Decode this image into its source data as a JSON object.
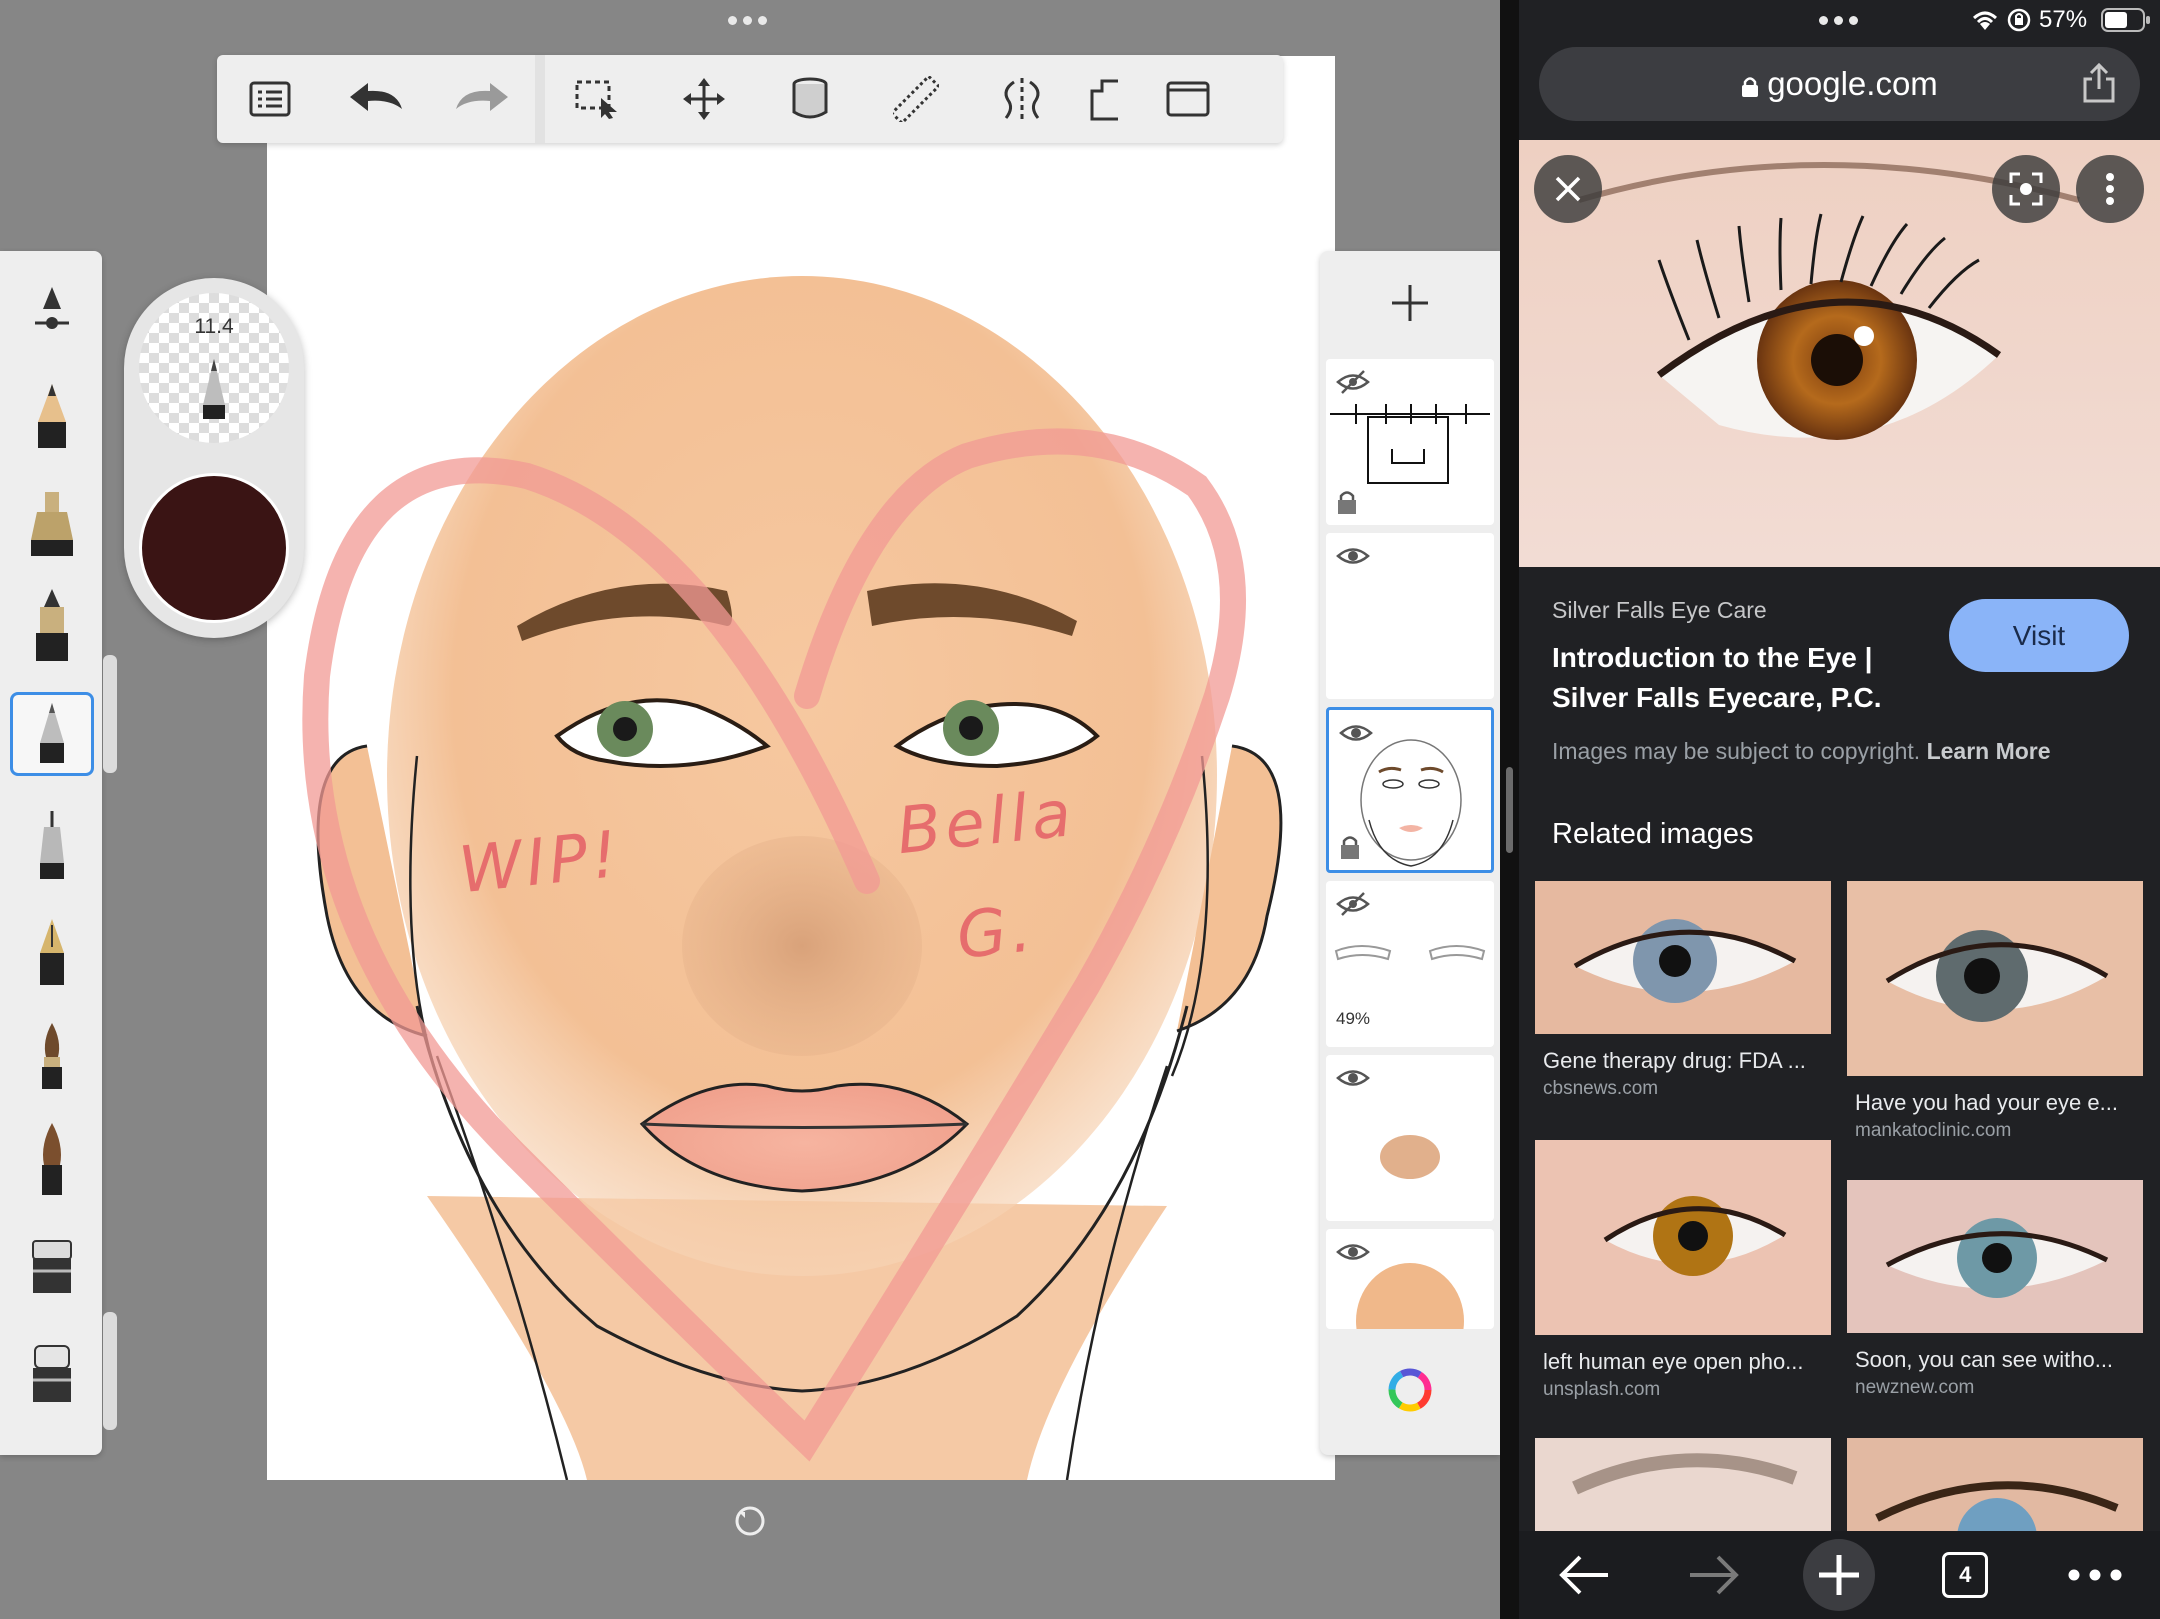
{
  "sketch": {
    "brush_size": "11.4",
    "brush_color": "#3a1414",
    "canvas_labels": {
      "left": "WIP!",
      "right_line1": "Bella",
      "right_line2": "G."
    },
    "layers": [
      {
        "visible": false,
        "locked": true,
        "opacity": ""
      },
      {
        "visible": true,
        "locked": false,
        "opacity": ""
      },
      {
        "visible": true,
        "locked": true,
        "opacity": "",
        "active": true
      },
      {
        "visible": false,
        "locked": false,
        "opacity": "49%"
      },
      {
        "visible": true,
        "locked": false,
        "opacity": ""
      },
      {
        "visible": true,
        "locked": false,
        "opacity": ""
      }
    ],
    "icons": [
      "list-icon",
      "undo-icon",
      "redo-icon",
      "selection-icon",
      "move-icon",
      "fill-icon",
      "ruler-icon",
      "symmetry-icon",
      "perspective-icon",
      "fullscreen-icon"
    ]
  },
  "browser": {
    "battery": "57%",
    "url": "google.com",
    "result": {
      "source": "Silver Falls Eye Care",
      "title": "Introduction to the Eye | Silver Falls Eyecare, P.C.",
      "visit_label": "Visit",
      "copyright": "Images may be subject to copyright.",
      "learn_more": "Learn More"
    },
    "related_title": "Related images",
    "related": [
      {
        "title": "Gene therapy drug: FDA ...",
        "domain": "cbsnews.com"
      },
      {
        "title": "Have you had your eye e...",
        "domain": "mankatoclinic.com"
      },
      {
        "title": "left human eye open pho...",
        "domain": "unsplash.com"
      },
      {
        "title": "Soon, you can see witho...",
        "domain": "newznew.com"
      }
    ],
    "tab_count": "4",
    "accent": "#8ab4f8"
  }
}
